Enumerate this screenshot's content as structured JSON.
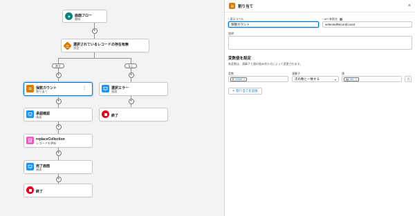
{
  "flow": {
    "start": {
      "title": "画面フロー",
      "sub": "開始"
    },
    "decision": {
      "title": "選択されているレコードの存在有無",
      "sub": "決定"
    },
    "branch_yes": "あり",
    "branch_no": "なし",
    "assign": {
      "title": "保数カウント",
      "sub": "割り当て"
    },
    "error_screen": {
      "title": "選択エラー",
      "sub": "画面"
    },
    "end_right": {
      "title": "終了"
    },
    "confirm_screen": {
      "title": "承認確認",
      "sub": "画面"
    },
    "replace": {
      "title": "replaceCollection",
      "sub": "レコードを更新"
    },
    "complete_screen": {
      "title": "完了画面",
      "sub": "画面"
    },
    "end_left": {
      "title": "終了"
    }
  },
  "panel": {
    "title": "割り当て",
    "label_field": {
      "label": "* 表示ラベル",
      "value": "保数カウント"
    },
    "api_field": {
      "label": "* API 参照名",
      "value": "selectedRecordCount"
    },
    "desc_field": {
      "label": "説明",
      "value": ""
    },
    "section_title": "変数値を設定",
    "section_desc": "各変数は、演算子と値の組み合わせによって変更されます。",
    "col_variable": "変数",
    "col_operator": "演算子",
    "col_value": "値",
    "row": {
      "variable": "count",
      "operator": "次の数と一致する",
      "value": "ids"
    },
    "add_button": "割り当てを追加"
  },
  "colors": {
    "start": "#0b827c",
    "decision": "#dd7a01",
    "assign": "#dd7a01",
    "screen": "#1b96ff",
    "end": "#ea001e",
    "record": "#e85fbf",
    "selected": "#0176d3"
  }
}
